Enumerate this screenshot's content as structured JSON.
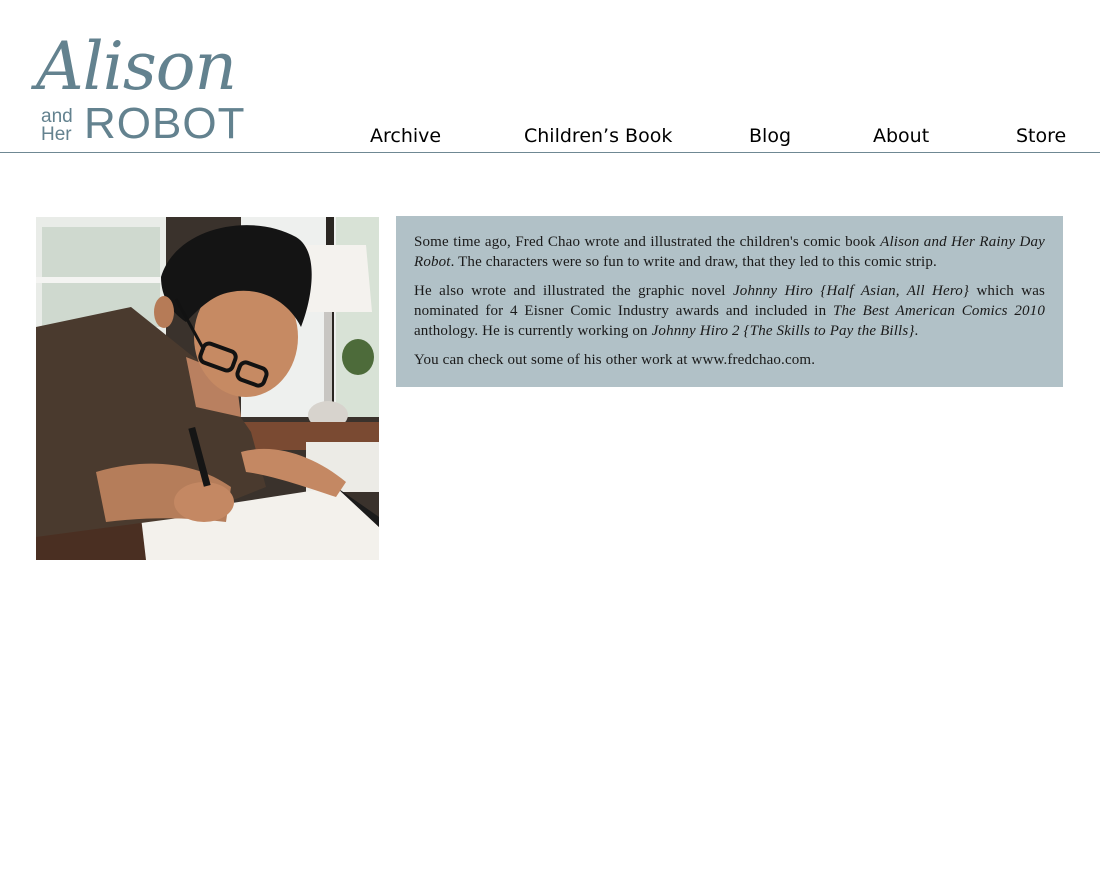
{
  "logo": {
    "script": "Alison",
    "and": "and",
    "her": "Her",
    "robot": "ROBOT"
  },
  "nav": {
    "items": [
      {
        "label": "Archive"
      },
      {
        "label": "Children’s Book"
      },
      {
        "label": "Blog"
      },
      {
        "label": "About"
      },
      {
        "label": "Store"
      }
    ]
  },
  "bio": {
    "p1": {
      "a": "Some time ago, Fred Chao wrote and illustrated the children's comic book ",
      "b": "Alison and Her Rainy Day Robot",
      "c": ". The characters were so fun to write and draw, that they led to this comic strip."
    },
    "p2": {
      "a": "He also wrote and illustrated the graphic novel ",
      "b": "Johnny Hiro {Half Asian, All Hero}",
      "c": " which was nominated for 4 Eisner Comic Industry awards and included in ",
      "d": "The Best American Comics 2010",
      "e": " anthology. He is currently working on ",
      "f": "Johnny Hiro 2 {The Skills to Pay the Bills}",
      "g": "."
    },
    "p3": "You can check out some of his other work at www.fredchao.com."
  },
  "colors": {
    "brand": "#63828f",
    "bio_background": "#b1c1c7",
    "header_rule": "#6f8893"
  }
}
